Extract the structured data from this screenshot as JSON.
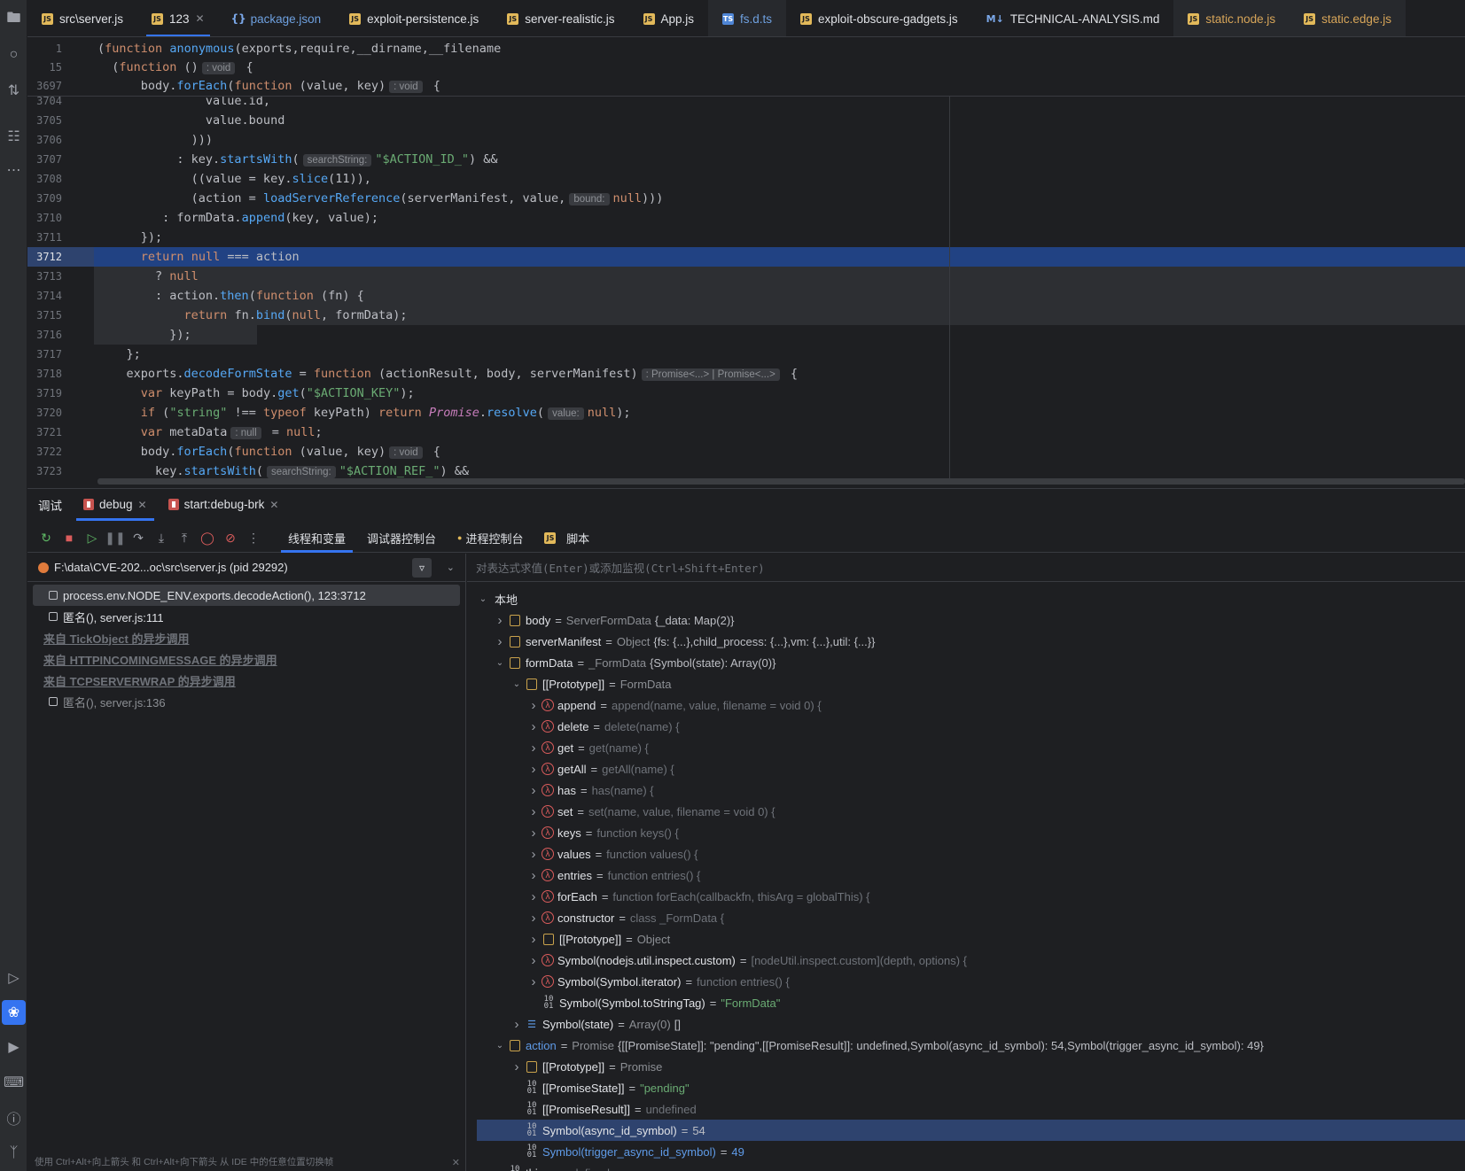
{
  "tabs": [
    {
      "label": "src\\server.js",
      "icon": "JS",
      "kind": "js"
    },
    {
      "label": "123",
      "icon": "JS",
      "kind": "js",
      "active": true,
      "closable": true
    },
    {
      "label": "package.json",
      "icon": "{}",
      "kind": "json"
    },
    {
      "label": "exploit-persistence.js",
      "icon": "JS",
      "kind": "js"
    },
    {
      "label": "server-realistic.js",
      "icon": "JS",
      "kind": "js"
    },
    {
      "label": "App.js",
      "icon": "JS",
      "kind": "js"
    },
    {
      "label": "fs.d.ts",
      "icon": "TS",
      "kind": "ts"
    },
    {
      "label": "exploit-obscure-gadgets.js",
      "icon": "JS",
      "kind": "js"
    },
    {
      "label": "TECHNICAL-ANALYSIS.md",
      "icon": "M↓",
      "kind": "md"
    },
    {
      "label": "static.node.js",
      "icon": "JS",
      "kind": "js"
    },
    {
      "label": "static.edge.js",
      "icon": "JS",
      "kind": "js"
    }
  ],
  "editor": {
    "sticky": [
      {
        "num": "1",
        "code": "(function anonymous(exports,require,__dirname,__filename"
      },
      {
        "num": "15",
        "code": "  (function ()",
        "hint": ": void",
        "after": " {"
      },
      {
        "num": "3697",
        "code": "      body.forEach(function (value, key)",
        "hint": ": void",
        "after": " {"
      }
    ],
    "lines": [
      {
        "num": "3704",
        "code": "               value.id,"
      },
      {
        "num": "3705",
        "code": "               value.bound"
      },
      {
        "num": "3706",
        "code": "             )))"
      },
      {
        "num": "3707",
        "code": "           : key.startsWith(",
        "hint": "searchString:",
        "after": "\"$ACTION_ID_\") &&"
      },
      {
        "num": "3708",
        "code": "             ((value = key.slice(11)),"
      },
      {
        "num": "3709",
        "code": "             (action = loadServerReference(serverManifest, value,",
        "hint": "bound:",
        "after": "null)))"
      },
      {
        "num": "3710",
        "code": "         : formData.append(key, value);"
      },
      {
        "num": "3711",
        "code": "      });"
      },
      {
        "num": "3712",
        "code": "      return null === action",
        "exec": true
      },
      {
        "num": "3713",
        "code": "        ? null",
        "sel": true
      },
      {
        "num": "3714",
        "code": "        : action.then(function (fn) {",
        "sel": true
      },
      {
        "num": "3715",
        "code": "            return fn.bind(null, formData);",
        "sel": true
      },
      {
        "num": "3716",
        "code": "          });",
        "sel": "partial"
      },
      {
        "num": "3717",
        "code": "    };"
      },
      {
        "num": "3718",
        "code": "    exports.decodeFormState = function (actionResult, body, serverManifest)",
        "hint": ": Promise<...> | Promise<...>",
        "after": " {"
      },
      {
        "num": "3719",
        "code": "      var keyPath = body.get(\"$ACTION_KEY\");"
      },
      {
        "num": "3720",
        "code": "      if (\"string\" !== typeof keyPath) return Promise.resolve(",
        "hint": "value:",
        "after": "null);"
      },
      {
        "num": "3721",
        "code": "      var metaData",
        "hint": ": null",
        "after": " = null;"
      },
      {
        "num": "3722",
        "code": "      body.forEach(function (value, key)",
        "hint": ": void",
        "after": " {"
      },
      {
        "num": "3723",
        "code": "        key.startsWith(",
        "hint": "searchString:",
        "after": "\"$ACTION_REF_\") &&"
      }
    ]
  },
  "debug": {
    "title": "调试",
    "sessions": [
      {
        "label": "debug",
        "active": true
      },
      {
        "label": "start:debug-brk",
        "active": false
      }
    ],
    "subtabs": [
      {
        "label": "线程和变量",
        "active": true
      },
      {
        "label": "调试器控制台"
      },
      {
        "label": "进程控制台"
      },
      {
        "label": "脚本"
      }
    ],
    "process": "F:\\data\\CVE-202...oc\\src\\server.js (pid 29292)",
    "frames": [
      {
        "label": "process.env.NODE_ENV.exports.decodeAction(), 123:3712",
        "kind": "frame",
        "selected": true
      },
      {
        "label": "匿名(), server.js:111",
        "kind": "frame"
      },
      {
        "label": "来自 TickObject 的异步调用",
        "kind": "async"
      },
      {
        "label": "来自 HTTPINCOMINGMESSAGE 的异步调用",
        "kind": "async"
      },
      {
        "label": "来自 TCPSERVERWRAP 的异步调用",
        "kind": "async"
      },
      {
        "label": "匿名(), server.js:136",
        "kind": "frame",
        "dim": true
      }
    ],
    "tip": "使用 Ctrl+Alt+向上箭头 和 Ctrl+Alt+向下箭头 从 IDE 中的任意位置切换帧",
    "eval_placeholder": "对表达式求值(Enter)或添加监视(Ctrl+Shift+Enter)",
    "variables": [
      {
        "depth": 0,
        "chev": "v",
        "icon": "none",
        "name": "本地"
      },
      {
        "depth": 1,
        "chev": ">",
        "icon": "obj",
        "name": "body",
        "type": "ServerFormData",
        "value": "{_data: Map(2)}"
      },
      {
        "depth": 1,
        "chev": ">",
        "icon": "obj",
        "name": "serverManifest",
        "type": "Object",
        "value": "{fs: {...},child_process: {...},vm: {...},util: {...}}"
      },
      {
        "depth": 1,
        "chev": "v",
        "icon": "obj",
        "name": "formData",
        "type": "_FormData",
        "value": "{Symbol(state): Array(0)}"
      },
      {
        "depth": 2,
        "chev": "v",
        "icon": "obj",
        "name": "[[Prototype]]",
        "type": "FormData",
        "value": ""
      },
      {
        "depth": 3,
        "chev": ">",
        "icon": "fn",
        "name": "append",
        "type": "",
        "value": "append(name, value, filename = void 0) {"
      },
      {
        "depth": 3,
        "chev": ">",
        "icon": "fn",
        "name": "delete",
        "type": "",
        "value": "delete(name) {"
      },
      {
        "depth": 3,
        "chev": ">",
        "icon": "fn",
        "name": "get",
        "type": "",
        "value": "get(name) {"
      },
      {
        "depth": 3,
        "chev": ">",
        "icon": "fn",
        "name": "getAll",
        "type": "",
        "value": "getAll(name) {"
      },
      {
        "depth": 3,
        "chev": ">",
        "icon": "fn",
        "name": "has",
        "type": "",
        "value": "has(name) {"
      },
      {
        "depth": 3,
        "chev": ">",
        "icon": "fn",
        "name": "set",
        "type": "",
        "value": "set(name, value, filename = void 0) {"
      },
      {
        "depth": 3,
        "chev": ">",
        "icon": "fn",
        "name": "keys",
        "type": "",
        "value": "function keys() {"
      },
      {
        "depth": 3,
        "chev": ">",
        "icon": "fn",
        "name": "values",
        "type": "",
        "value": "function values() {"
      },
      {
        "depth": 3,
        "chev": ">",
        "icon": "fn",
        "name": "entries",
        "type": "",
        "value": "function entries() {"
      },
      {
        "depth": 3,
        "chev": ">",
        "icon": "fn",
        "name": "forEach",
        "type": "",
        "value": "function forEach(callbackfn, thisArg = globalThis) {"
      },
      {
        "depth": 3,
        "chev": ">",
        "icon": "fn",
        "name": "constructor",
        "type": "",
        "value": "class _FormData {"
      },
      {
        "depth": 3,
        "chev": ">",
        "icon": "obj",
        "name": "[[Prototype]]",
        "type": "Object",
        "value": ""
      },
      {
        "depth": 3,
        "chev": ">",
        "icon": "fn",
        "name": "Symbol(nodejs.util.inspect.custom)",
        "type": "",
        "value": "[nodeUtil.inspect.custom](depth, options) {"
      },
      {
        "depth": 3,
        "chev": ">",
        "icon": "fn",
        "name": "Symbol(Symbol.iterator)",
        "type": "",
        "value": "function entries() {"
      },
      {
        "depth": 3,
        "chev": "",
        "icon": "prim",
        "name": "Symbol(Symbol.toStringTag)",
        "type": "",
        "value": "\"FormData\"",
        "valkind": "str"
      },
      {
        "depth": 2,
        "chev": ">",
        "icon": "arr",
        "name": "Symbol(state)",
        "type": "Array(0)",
        "value": "[]"
      },
      {
        "depth": 1,
        "chev": "v",
        "icon": "obj",
        "name": "action",
        "type": "Promise",
        "value": "{[[PromiseState]]: \"pending\",[[PromiseResult]]: undefined,Symbol(async_id_symbol): 54,Symbol(trigger_async_id_symbol): 49}",
        "namekind": "blue"
      },
      {
        "depth": 2,
        "chev": ">",
        "icon": "obj",
        "name": "[[Prototype]]",
        "type": "Promise",
        "value": ""
      },
      {
        "depth": 2,
        "chev": "",
        "icon": "prim",
        "name": "[[PromiseState]]",
        "type": "",
        "value": "\"pending\"",
        "valkind": "str"
      },
      {
        "depth": 2,
        "chev": "",
        "icon": "prim",
        "name": "[[PromiseResult]]",
        "type": "",
        "value": "undefined",
        "valkind": "dim"
      },
      {
        "depth": 2,
        "chev": "",
        "icon": "prim",
        "name": "Symbol(async_id_symbol)",
        "type": "",
        "value": "54",
        "selected": true
      },
      {
        "depth": 2,
        "chev": "",
        "icon": "prim",
        "name": "Symbol(trigger_async_id_symbol)",
        "type": "",
        "value": "49",
        "valkind": "num",
        "namekind": "blue"
      },
      {
        "depth": 1,
        "chev": "",
        "icon": "prim",
        "name": "this",
        "type": "",
        "value": "undefined",
        "valkind": "dim"
      }
    ]
  },
  "activity_icons": [
    "folder-icon",
    "commit-icon",
    "pull-request-icon",
    "structure-icon",
    "more-icon",
    "run-icon",
    "debug-icon",
    "services-icon",
    "terminal-icon",
    "problems-icon",
    "git-icon"
  ]
}
